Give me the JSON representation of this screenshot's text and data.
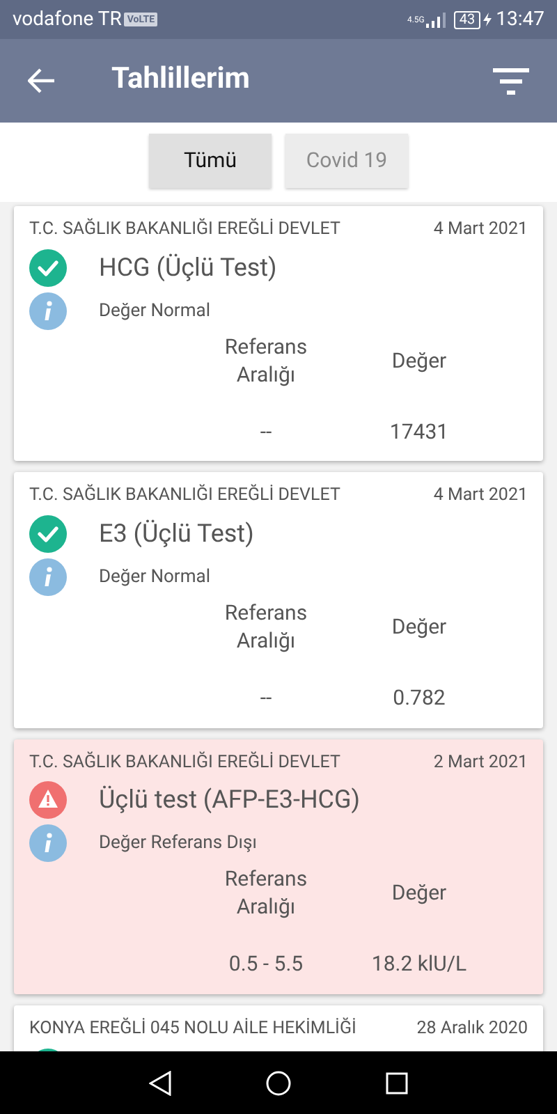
{
  "status_bar": {
    "carrier": "vodafone TR",
    "volte_badge": "VoLTE",
    "network": "4.5G",
    "battery": "43",
    "time": "13:47"
  },
  "app_bar": {
    "title": "Tahlillerim"
  },
  "tabs": [
    {
      "label": "Tümü",
      "selected": true
    },
    {
      "label": "Covid 19",
      "selected": false
    }
  ],
  "results": [
    {
      "institution": "T.C. SAĞLIK BAKANLIĞI EREĞLİ DEVLET",
      "date": "4 Mart 2021",
      "kind": "normal",
      "test": "HCG (Üçlü Test)",
      "note": "Değer Normal",
      "reference_header": "Referans Aralığı",
      "value_header": "Değer",
      "reference": "--",
      "value": "17431"
    },
    {
      "institution": "T.C. SAĞLIK BAKANLIĞI EREĞLİ DEVLET",
      "date": "4 Mart 2021",
      "kind": "normal",
      "test": "E3 (Üçlü Test)",
      "note": "Değer Normal",
      "reference_header": "Referans Aralığı",
      "value_header": "Değer",
      "reference": "--",
      "value": "0.782"
    },
    {
      "institution": "T.C. SAĞLIK BAKANLIĞI EREĞLİ DEVLET",
      "date": "2 Mart 2021",
      "kind": "abnormal",
      "test": "Üçlü test (AFP-E3-HCG)",
      "note": "Değer Referans Dışı",
      "reference_header": "Referans Aralığı",
      "value_header": "Değer",
      "reference": "0.5 - 5.5",
      "value": "18.2 klU/L"
    },
    {
      "institution": "KONYA EREĞLİ 045 NOLU AİLE HEKİMLİĞİ",
      "date": "28 Aralık 2020",
      "kind": "normal"
    }
  ]
}
